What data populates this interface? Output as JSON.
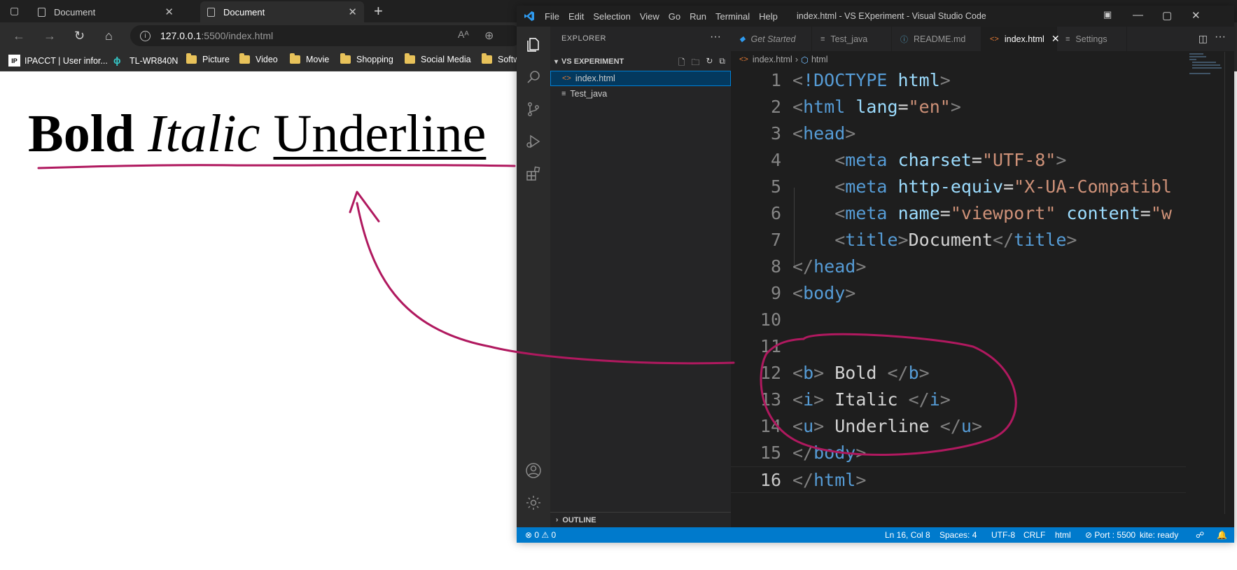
{
  "browser": {
    "tabs": [
      {
        "title": "Document",
        "active": false
      },
      {
        "title": "Document",
        "active": true
      }
    ],
    "new_tab_icon": "plus-icon",
    "url": {
      "host": "127.0.0.1",
      "rest": ":5500/index.html"
    },
    "bookmarks": [
      {
        "label": "IPACCT | User infor...",
        "icon": "ipacct-logo"
      },
      {
        "label": "TL-WR840N",
        "icon": "tplink-logo"
      },
      {
        "label": "Picture",
        "icon": "folder-icon"
      },
      {
        "label": "Video",
        "icon": "folder-icon"
      },
      {
        "label": "Movie",
        "icon": "folder-icon"
      },
      {
        "label": "Shopping",
        "icon": "folder-icon"
      },
      {
        "label": "Social Media",
        "icon": "folder-icon"
      },
      {
        "label": "Softw",
        "icon": "folder-icon"
      }
    ],
    "page": {
      "bold": "Bold",
      "italic": "Italic",
      "underline": "Underline"
    }
  },
  "vscode": {
    "menu": [
      "File",
      "Edit",
      "Selection",
      "View",
      "Go",
      "Run",
      "Terminal",
      "Help"
    ],
    "window_title": "index.html - VS EXperiment - Visual Studio Code",
    "explorer": {
      "title": "EXPLORER",
      "section": "VS EXPERIMENT",
      "files": [
        {
          "name": "index.html",
          "selected": true
        },
        {
          "name": "Test_java",
          "selected": false
        }
      ],
      "outline": "OUTLINE"
    },
    "tabs": [
      {
        "label": "Get Started"
      },
      {
        "label": "Test_java"
      },
      {
        "label": "README.md"
      },
      {
        "label": "index.html"
      },
      {
        "label": "Settings"
      }
    ],
    "breadcrumb": [
      "index.html",
      "html"
    ],
    "line_numbers": [
      "1",
      "2",
      "3",
      "4",
      "5",
      "6",
      "7",
      "8",
      "9",
      "10",
      "11",
      "12",
      "13",
      "14",
      "15",
      "16"
    ],
    "code": {
      "l1": {
        "tag": "!DOCTYPE",
        "attr": "html"
      },
      "l2": {
        "tag": "html",
        "attr": "lang",
        "val": "\"en\""
      },
      "l3": {
        "tag": "head"
      },
      "l4": {
        "tag": "meta",
        "attr": "charset",
        "val": "\"UTF-8\""
      },
      "l5": {
        "tag": "meta",
        "attr": "http-equiv",
        "val": "\"X-UA-Compatibl"
      },
      "l6": {
        "tag": "meta",
        "attr": "name",
        "val": "\"viewport\"",
        "attr2": "content",
        "val2": "\"w"
      },
      "l7": {
        "tag": "title",
        "text": "Document"
      },
      "l8": {
        "tag": "head"
      },
      "l9": {
        "tag": "body"
      },
      "l12": {
        "tag": "b",
        "text": " Bold "
      },
      "l13": {
        "tag": "i",
        "text": " Italic "
      },
      "l14": {
        "tag": "u",
        "text": " Underline "
      },
      "l15": {
        "tag": "body"
      },
      "l16": {
        "tag": "html"
      }
    },
    "status": {
      "errors": "0",
      "warnings": "0",
      "position": "Ln 16, Col 8",
      "spaces": "Spaces: 4",
      "encoding": "UTF-8",
      "eol": "CRLF",
      "language": "html",
      "port": "Port : 5500",
      "kite": "kite: ready"
    }
  },
  "colors": {
    "annotation": "#b0195f",
    "statusbar": "#007acc"
  }
}
